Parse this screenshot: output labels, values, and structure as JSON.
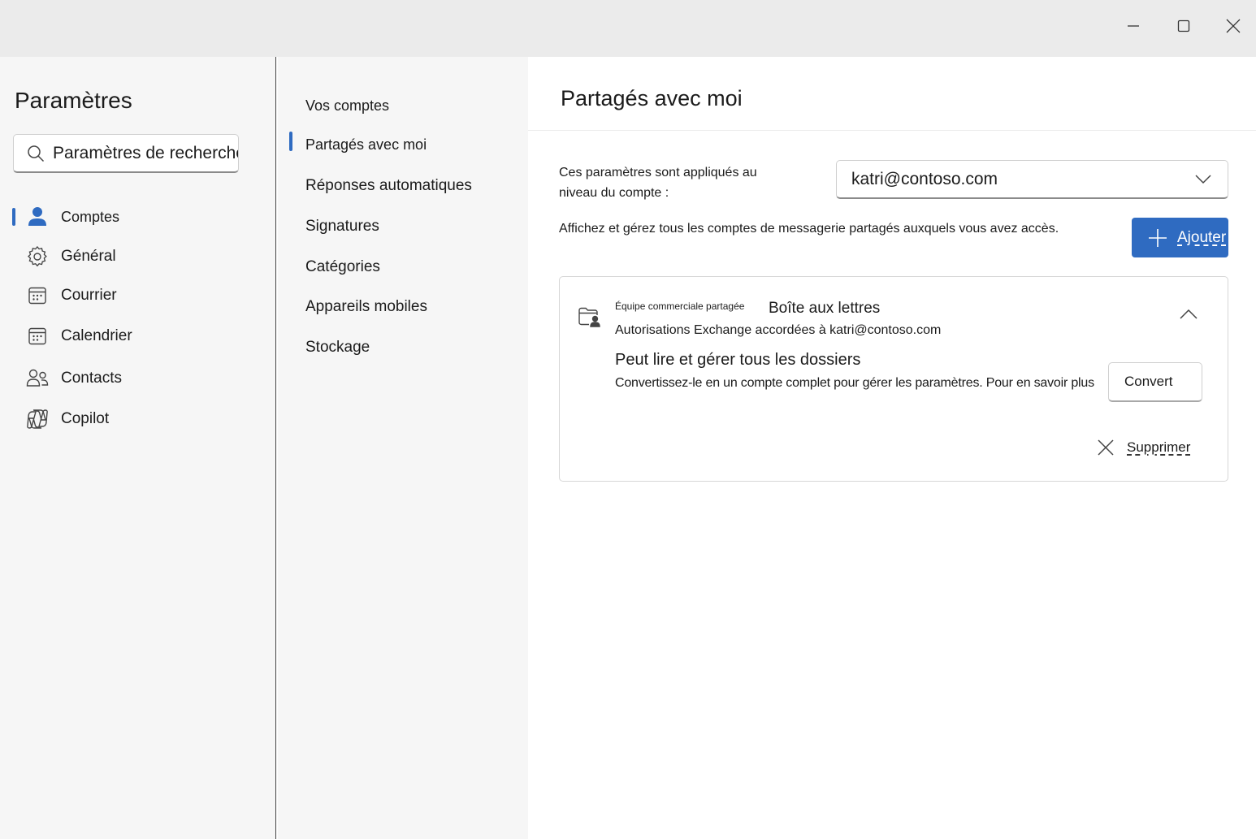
{
  "window": {
    "controls": {
      "minimize": "minimize-icon",
      "maximize": "maximize-icon",
      "close": "close-icon"
    }
  },
  "sidebar": {
    "title": "Paramètres",
    "search_placeholder": "Paramètres de recherche",
    "items": [
      {
        "label": "Comptes",
        "icon": "person-icon",
        "selected": true
      },
      {
        "label": "Général",
        "icon": "gear-icon",
        "selected": false
      },
      {
        "label": "Courrier",
        "icon": "calendar-icon",
        "selected": false
      },
      {
        "label": "Calendrier",
        "icon": "calendar-icon",
        "selected": false
      },
      {
        "label": "Contacts",
        "icon": "people-icon",
        "selected": false
      },
      {
        "label": "Copilot",
        "icon": "copilot-icon",
        "selected": false
      }
    ]
  },
  "subnav": {
    "items": [
      {
        "label": "Vos comptes",
        "selected": false
      },
      {
        "label": "Partagés avec moi",
        "selected": true
      },
      {
        "label": "Réponses automatiques",
        "selected": false
      },
      {
        "label": "Signatures",
        "selected": false
      },
      {
        "label": "Catégories",
        "selected": false
      },
      {
        "label": "Appareils mobiles",
        "selected": false
      },
      {
        "label": "Stockage",
        "selected": false
      }
    ]
  },
  "main": {
    "title": "Partagés avec moi",
    "applied_label": "Ces paramètres sont appliqués au niveau du compte :",
    "account_selected": "katri@contoso.com",
    "description": "Affichez et gérez tous les comptes de messagerie partagés auxquels vous avez accès.",
    "add_button": "Ajouter",
    "card": {
      "mailbox_name": "Équipe commerciale partagée",
      "mailbox_type": "Boîte aux lettres",
      "permission": "Autorisations Exchange accordées à katri@contoso.com",
      "capability_title": "Peut lire et gérer tous les dossiers",
      "capability_desc": "Convertissez-le en un compte complet pour gérer les paramètres. Pour en savoir plus",
      "convert_button": "Convert",
      "delete_button": "Supprimer"
    }
  },
  "colors": {
    "accent": "#2f6bc1",
    "nav_bg": "#f6f6f6",
    "titlebar_bg": "#ebebeb"
  }
}
